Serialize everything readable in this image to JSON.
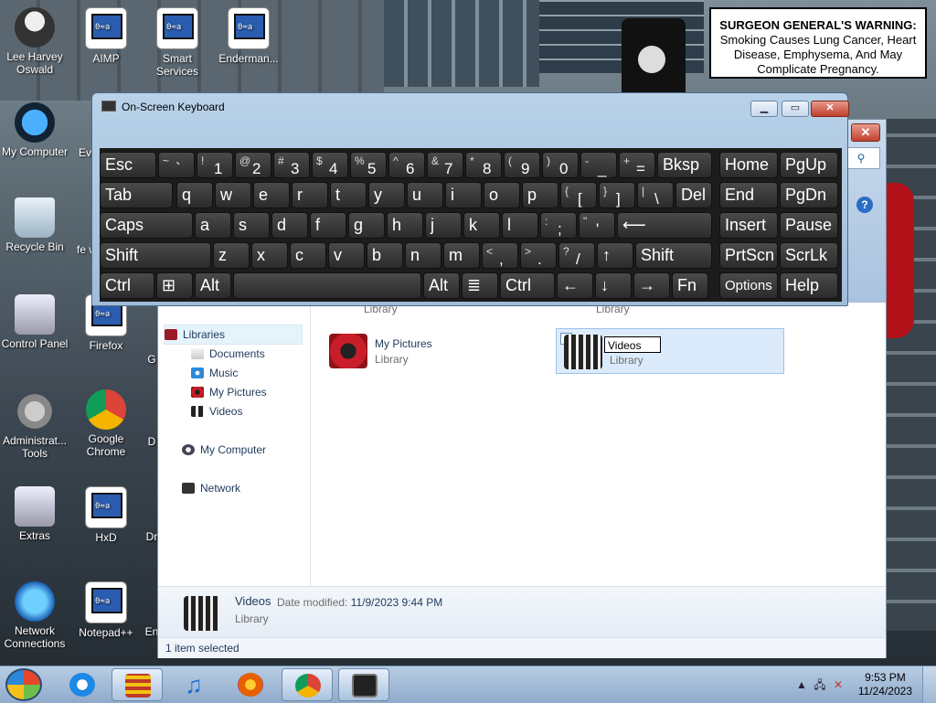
{
  "warning": {
    "bold": "SURGEON GENERAL'S WARNING:",
    "text": "Smoking Causes Lung Cancer, Heart Disease, Emphysema, And May Complicate Pregnancy."
  },
  "desktop_icons": [
    {
      "label": "Lee Harvey Oswald"
    },
    {
      "label": "AIMP"
    },
    {
      "label": "Smart Services"
    },
    {
      "label": "Enderman..."
    },
    {
      "label": "My Computer"
    },
    {
      "label": "Ev"
    },
    {
      "label": "Recycle Bin"
    },
    {
      "label": "fe w"
    },
    {
      "label": "Control Panel"
    },
    {
      "label": "Firefox"
    },
    {
      "label": "G"
    },
    {
      "label": "Administrat... Tools"
    },
    {
      "label": "Google Chrome"
    },
    {
      "label": "D"
    },
    {
      "label": "Extras"
    },
    {
      "label": "HxD"
    },
    {
      "label": "Dr"
    },
    {
      "label": "Network Connections"
    },
    {
      "label": "Notepad++"
    },
    {
      "label": "En"
    }
  ],
  "osk": {
    "title": "On-Screen Keyboard",
    "rows": [
      [
        "Esc",
        "~ `",
        "! 1",
        "@ 2",
        "# 3",
        "$ 4",
        "% 5",
        "^ 6",
        "& 7",
        "* 8",
        "( 9",
        ") 0",
        "- _",
        "+ =",
        "Bksp",
        "Home",
        "PgUp"
      ],
      [
        "Tab",
        "q",
        "w",
        "e",
        "r",
        "t",
        "y",
        "u",
        "i",
        "o",
        "p",
        "{ [",
        "} ]",
        "| \\",
        "Del",
        "End",
        "PgDn"
      ],
      [
        "Caps",
        "a",
        "s",
        "d",
        "f",
        "g",
        "h",
        "j",
        "k",
        "l",
        ": ;",
        "\" '",
        "⟵",
        "Insert",
        "Pause"
      ],
      [
        "Shift",
        "z",
        "x",
        "c",
        "v",
        "b",
        "n",
        "m",
        "< ,",
        "> .",
        "? /",
        "↑",
        "Shift",
        "PrtScn",
        "ScrLk"
      ],
      [
        "Ctrl",
        "⊞",
        "Alt",
        "",
        "Alt",
        "≣",
        "Ctrl",
        "←",
        "↓",
        "→",
        "Fn",
        "Options",
        "Help"
      ]
    ]
  },
  "explorer": {
    "nav": [
      {
        "label": "Libraries"
      },
      {
        "label": "Documents"
      },
      {
        "label": "Music"
      },
      {
        "label": "My Pictures"
      },
      {
        "label": "Videos"
      },
      {
        "label": "My Computer"
      },
      {
        "label": "Network"
      }
    ],
    "tiles": [
      {
        "name": "My Pictures",
        "type": "Library"
      },
      {
        "name": "Videos",
        "type": "Library"
      }
    ],
    "partial_tiles": [
      {
        "type": "Library"
      },
      {
        "type": "Library"
      }
    ],
    "details": {
      "name": "Videos",
      "modified_label": "Date modified:",
      "modified_value": "11/9/2023 9:44 PM",
      "type": "Library"
    },
    "status": "1 item selected"
  },
  "clock": {
    "time": "9:53 PM",
    "date": "11/24/2023"
  },
  "icons": {
    "start": "windows-orb-icon",
    "ie": "internet-explorer-icon",
    "tray_arrow": "show-hidden-icons-icon",
    "network": "network-icon",
    "volume": "volume-muted-icon"
  }
}
